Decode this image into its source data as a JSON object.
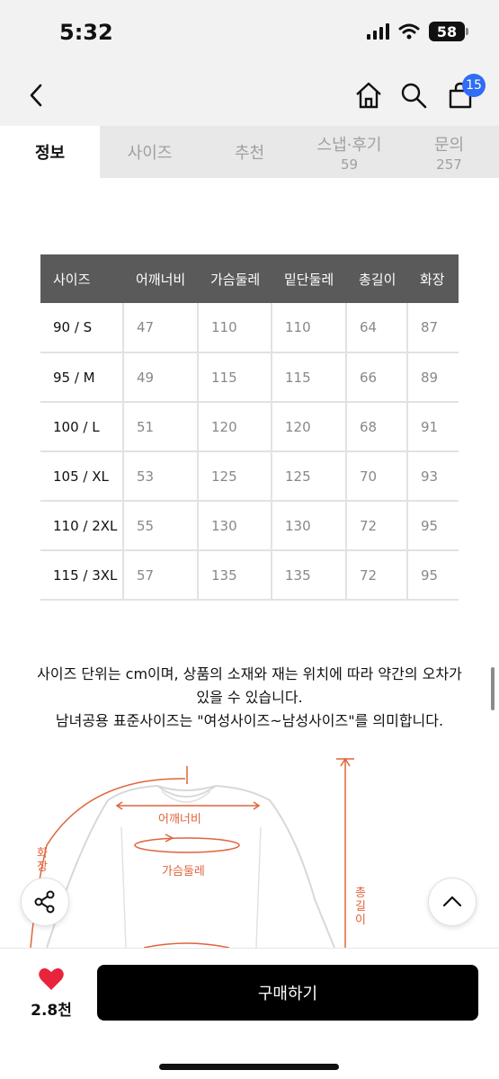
{
  "status_bar": {
    "time": "5:32",
    "battery": "58"
  },
  "nav": {
    "cart_count": "15"
  },
  "tabs": [
    {
      "label": "정보",
      "count": ""
    },
    {
      "label": "사이즈",
      "count": ""
    },
    {
      "label": "추천",
      "count": ""
    },
    {
      "label": "스냅·후기",
      "count": "59"
    },
    {
      "label": "문의",
      "count": "257"
    }
  ],
  "size_table": {
    "headers": [
      "사이즈",
      "어깨너비",
      "가슴둘레",
      "밑단둘레",
      "총길이",
      "화장"
    ],
    "rows": [
      [
        "90 / S",
        "47",
        "110",
        "110",
        "64",
        "87"
      ],
      [
        "95 / M",
        "49",
        "115",
        "115",
        "66",
        "89"
      ],
      [
        "100 / L",
        "51",
        "120",
        "120",
        "68",
        "91"
      ],
      [
        "105 / XL",
        "53",
        "125",
        "125",
        "70",
        "93"
      ],
      [
        "110 / 2XL",
        "55",
        "130",
        "130",
        "72",
        "95"
      ],
      [
        "115 / 3XL",
        "57",
        "135",
        "135",
        "72",
        "95"
      ]
    ]
  },
  "notes": {
    "line1": "사이즈 단위는 cm이며, 상품의 소재와 재는 위치에 따라 약간의 오차가",
    "line2": "있을 수 있습니다.",
    "line3": "남녀공용 표준사이즈는 \"여성사이즈~남성사이즈\"를 의미합니다."
  },
  "diagram": {
    "shoulder": "어깨너비",
    "chest": "가슴둘레",
    "sleeve": "화장",
    "length": "총길이"
  },
  "bottom_bar": {
    "like_count": "2.8천",
    "buy_label": "구매하기"
  },
  "colors": {
    "accent_badge": "#2f6df6",
    "diagram_orange": "#e0643c",
    "like_red": "#e8243c",
    "table_header": "#5a5a5a"
  },
  "icons": [
    "back-arrow-icon",
    "home-icon",
    "search-icon",
    "cart-icon",
    "share-icon",
    "chevron-up-icon",
    "heart-icon"
  ]
}
